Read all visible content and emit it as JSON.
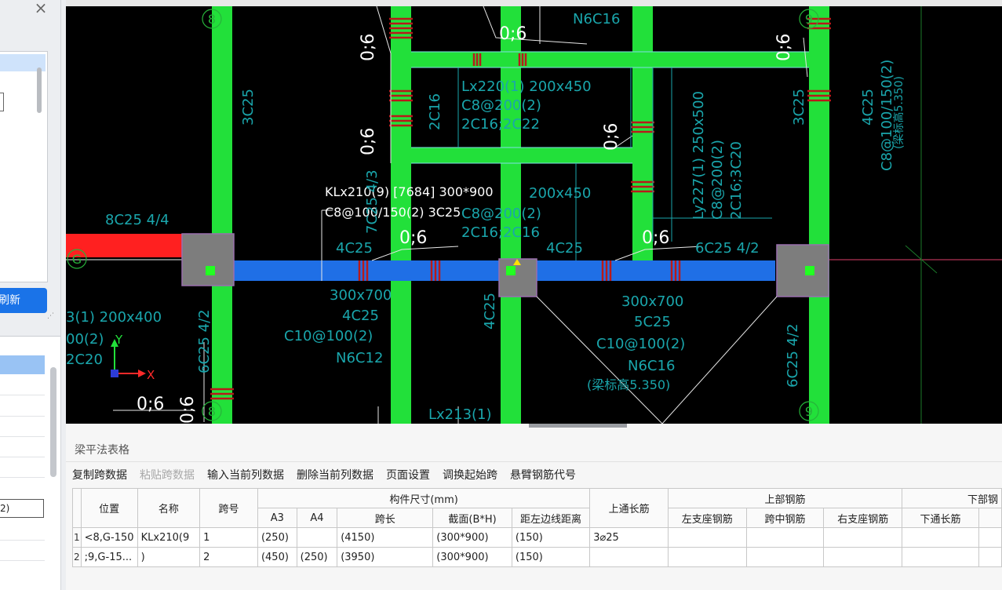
{
  "left_panel": {
    "close_glyph": "×",
    "refresh_label": "刷新",
    "input_value": "2)"
  },
  "cad": {
    "axis_labels": {
      "axis_8_top": "8",
      "axis_9_top": "9",
      "axis_8_bottom": "8",
      "axis_9_bottom": "9",
      "axis_G": "G"
    },
    "ucs": {
      "x": "X",
      "y": "Y"
    },
    "selected_beam": {
      "line1": "KLx210(9) [7684] 300*900",
      "line2": "C8@100/150(2) 3C25"
    },
    "texts": {
      "t_06_a": "0;6",
      "t_06_b": "0;6",
      "t_06_c": "0;6",
      "t_06_d": "0;6",
      "t_06_e": "0;6",
      "t_06_f": "0;6",
      "t_06_g": "0;6",
      "t_06_h": "0;6",
      "t_06_i": "0;6",
      "n6c16_top": "N6C16",
      "lx220_1": "Lx220(1) 200x450",
      "lx220_2": "C8@200(2)",
      "lx220_3": "2C16;2C22",
      "v_2c16": "2C16",
      "v_3c25_left": "3C25",
      "v_3c25_right": "3C25",
      "ly227_1": "Ly227(1) 250x500",
      "ly227_2": "C8@200(2)",
      "ly227_3": "2C16;3C20",
      "right_v1": "4C25",
      "right_v2": "C8@100/150(2)",
      "right_v3": "(梁标高5.350)",
      "mid_1": "200x450",
      "mid_2": "C8@200(2)",
      "mid_3": "2C16;2C16",
      "t_8c25": "8C25 4/4",
      "t_4c25_a": "4C25",
      "t_4c25_b": "4C25",
      "t_6c25_42": "6C25 4/2",
      "left_b1": "300x700",
      "left_b2": "4C25",
      "left_b3": "C10@100(2)",
      "left_b4": "N6C12",
      "right_b1": "300x700",
      "right_b2": "5C25",
      "right_b3": "C10@100(2)",
      "right_b4": "N6C16",
      "right_b5": "(梁标高5.350)",
      "v_4c25_center": "4C25",
      "v_6c25_left": "6C25 4/2",
      "v_6c25_right": "6C25 4/2",
      "left_edge_1": "3(1) 200x400",
      "left_edge_2": "00(2)",
      "left_edge_3": "2C20",
      "lx213": "Lx213(1)",
      "v_7c25": "7C25 4/3"
    }
  },
  "table_panel": {
    "title": "梁平法表格",
    "toolbar": [
      "复制跨数据",
      "粘贴跨数据",
      "输入当前列数据",
      "删除当前列数据",
      "页面设置",
      "调换起始跨",
      "悬臂钢筋代号"
    ],
    "toolbar_disabled_index": 1,
    "headers": {
      "pos": "位置",
      "name": "名称",
      "span": "跨号",
      "size_group": "构件尺寸(mm)",
      "a3": "A3",
      "a4": "A4",
      "length": "跨长",
      "section": "截面(B*H)",
      "dist": "距左边线距离",
      "top_through": "上通长筋",
      "top_group": "上部钢筋",
      "left_sup": "左支座钢筋",
      "mid": "跨中钢筋",
      "right_sup": "右支座钢筋",
      "bottom_group": "下部钢",
      "bottom_through": "下通长筋"
    },
    "rows": [
      {
        "rownum": "1",
        "pos": "<8,G-150",
        "name": "KLx210(9",
        "span": "1",
        "a3": "(250)",
        "a4": "",
        "length": "(4150)",
        "section": "(300*900)",
        "dist": "(150)",
        "top_through": "3⌀25"
      },
      {
        "rownum": "2",
        "pos": ";9,G-15...",
        "name": ")",
        "span": "2",
        "a3": "(450)",
        "a4": "(250)",
        "length": "(3950)",
        "section": "(300*900)",
        "dist": "(150)",
        "top_through": ""
      }
    ]
  },
  "colors": {
    "cad_bg": "#000000",
    "column_green": "#22e03a",
    "selected_beam_blue": "#1f6fe6",
    "red_beam": "#ff2020",
    "cyan_text": "#1aa6ac",
    "accent_blue": "#1a73e8"
  }
}
